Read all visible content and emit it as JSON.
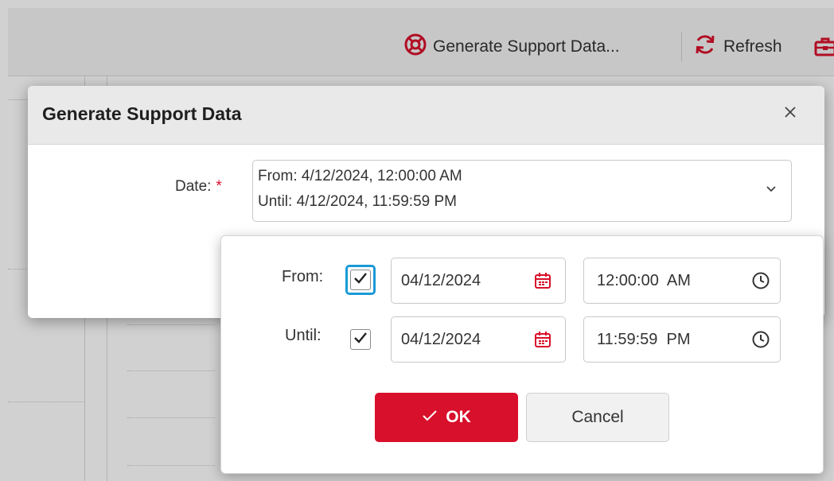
{
  "toolbar": {
    "generate_support_label": "Generate Support Data...",
    "refresh_label": "Refresh"
  },
  "dialog": {
    "title": "Generate Support Data",
    "date_label": "Date:",
    "required_mark": "*",
    "date_summary_from": "From: 4/12/2024, 12:00:00 AM",
    "date_summary_until": "Until: 4/12/2024, 11:59:59 PM"
  },
  "range_popup": {
    "from": {
      "label": "From:",
      "checked": true,
      "date": "04/12/2024",
      "time": "12:00:00  AM"
    },
    "until": {
      "label": "Until:",
      "checked": true,
      "date": "04/12/2024",
      "time": "11:59:59  PM"
    },
    "ok_label": "OK",
    "cancel_label": "Cancel"
  },
  "colors": {
    "accent": "#d8102b",
    "focus": "#1b9ad6"
  },
  "icons": [
    "lifebuoy-icon",
    "refresh-icon",
    "toolbox-icon",
    "close-icon",
    "chevron-down-icon",
    "check-icon",
    "calendar-icon",
    "clock-icon"
  ]
}
